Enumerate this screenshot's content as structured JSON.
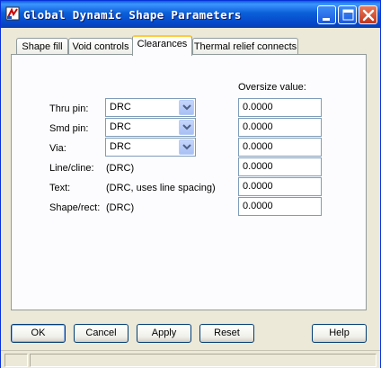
{
  "window": {
    "title": "Global Dynamic Shape Parameters"
  },
  "titlebar_buttons": [
    "minimize-icon",
    "maximize-icon",
    "close-icon"
  ],
  "tabs": [
    {
      "label": "Shape fill",
      "active": false
    },
    {
      "label": "Void controls",
      "active": false
    },
    {
      "label": "Clearances",
      "active": true
    },
    {
      "label": "Thermal relief connects",
      "active": false
    }
  ],
  "clearances": {
    "oversize_header": "Oversize value:",
    "rows": [
      {
        "label": "Thru pin:",
        "type": "combo",
        "value": "DRC",
        "oversize": "0.0000"
      },
      {
        "label": "Smd pin:",
        "type": "combo",
        "value": "DRC",
        "oversize": "0.0000"
      },
      {
        "label": "Via:",
        "type": "combo",
        "value": "DRC",
        "oversize": "0.0000"
      },
      {
        "label": "Line/cline:",
        "type": "text",
        "value": "(DRC)",
        "oversize": "0.0000"
      },
      {
        "label": "Text:",
        "type": "text",
        "value": "(DRC, uses line spacing)",
        "oversize": "0.0000"
      },
      {
        "label": "Shape/rect:",
        "type": "text",
        "value": "(DRC)",
        "oversize": "0.0000"
      }
    ]
  },
  "buttons": {
    "ok": "OK",
    "cancel": "Cancel",
    "apply": "Apply",
    "reset": "Reset",
    "help": "Help"
  },
  "colors": {
    "titlebar": "#0a5fd8",
    "dialog_bg": "#ece9d8",
    "active_tab_accent": "#ffc83c",
    "close_button": "#c2351a"
  }
}
